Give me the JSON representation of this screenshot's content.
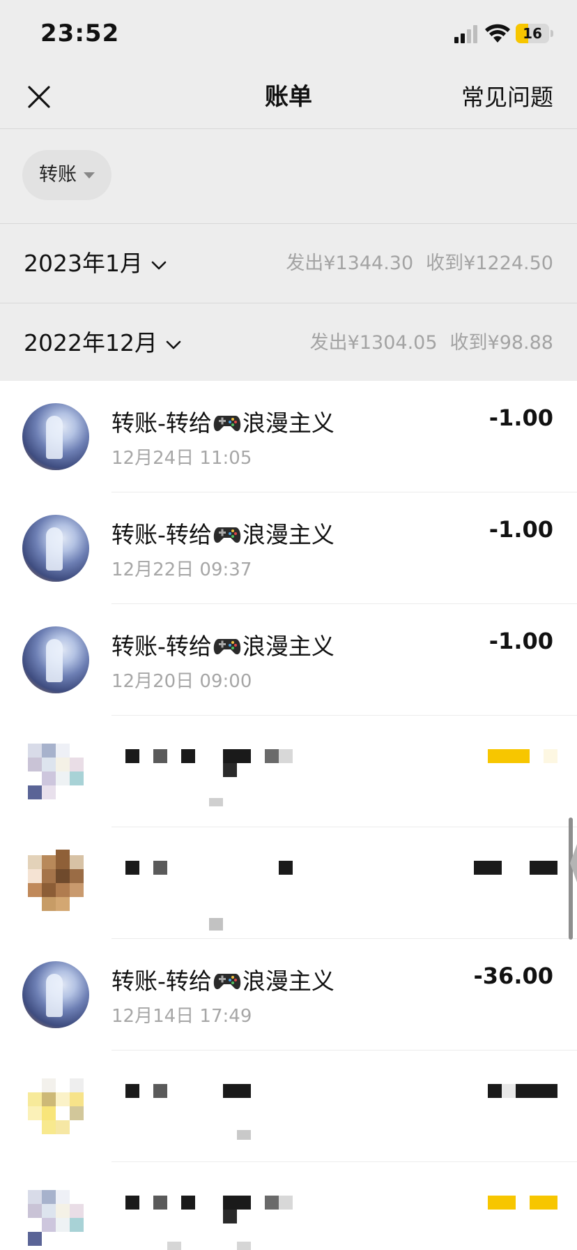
{
  "status_bar": {
    "time": "23:52",
    "battery": "16",
    "battery_fraction": 0.16
  },
  "nav": {
    "close_icon": "close-icon",
    "title": "账单",
    "faq": "常见问题"
  },
  "filter": {
    "label": "转账",
    "icon": "caret-down-icon"
  },
  "months": [
    {
      "title": "2023年1月",
      "sent": "发出¥1344.30",
      "received": "收到¥1224.50"
    },
    {
      "title": "2022年12月",
      "sent": "发出¥1304.05",
      "received": "收到¥98.88"
    }
  ],
  "transactions": [
    {
      "title_prefix": "转账-转给",
      "title_suffix": "浪漫主义",
      "time": "12月24日 11:05",
      "amount": "-1.00",
      "avatar": "anime-avatar"
    },
    {
      "title_prefix": "转账-转给",
      "title_suffix": "浪漫主义",
      "time": "12月22日 09:37",
      "amount": "-1.00",
      "avatar": "anime-avatar"
    },
    {
      "title_prefix": "转账-转给",
      "title_suffix": "浪漫主义",
      "time": "12月20日 09:00",
      "amount": "-1.00",
      "avatar": "anime-avatar"
    },
    {
      "title_prefix": "转账-转给",
      "title_suffix": "浪漫主义",
      "time": "12月14日 17:49",
      "amount": "-36.00",
      "avatar": "anime-avatar"
    }
  ],
  "colors": {
    "background": "#ededed",
    "list_background": "#ffffff",
    "text_primary": "#111111",
    "text_secondary": "#a6a6a6",
    "redaction_yellow": "#f7c600",
    "battery_yellow": "#f7c600"
  }
}
